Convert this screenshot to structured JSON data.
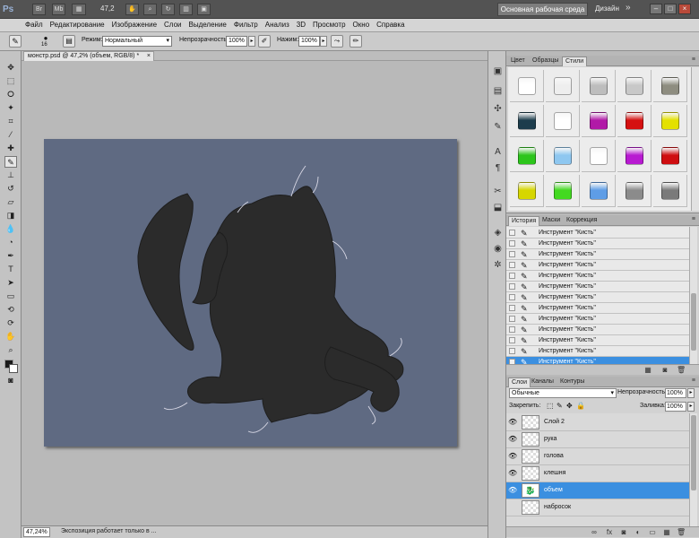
{
  "app": {
    "logo": "Ps",
    "top_buttons": [
      "Br",
      "Mb"
    ],
    "zoom_menu": "47,2",
    "workspace_label": "Основная рабочая среда",
    "design_label": "Дизайн",
    "more_label": "»",
    "window_controls": [
      "–",
      "□",
      "×"
    ]
  },
  "menu": [
    "Файл",
    "Редактирование",
    "Изображение",
    "Слои",
    "Выделение",
    "Фильтр",
    "Анализ",
    "3D",
    "Просмотр",
    "Окно",
    "Справка"
  ],
  "options_bar": {
    "brush_size": "16",
    "mode_label": "Режим:",
    "mode_value": "Нормальный",
    "opacity_label": "Непрозрачность:",
    "opacity_value": "100%",
    "pressure_label": "Нажим:",
    "pressure_value": "100%"
  },
  "document": {
    "tab_title": "монстр.psd @ 47,2% (объем, RGB/8) *",
    "tab_close": "×",
    "canvas_color": "#5f6a82"
  },
  "statusbar": {
    "zoom": "47,24%",
    "message": "Экспозиция работает только в ..."
  },
  "styles_panel": {
    "tabs": [
      "Цвет",
      "Образцы",
      "Стили"
    ],
    "active_tab": "Стили",
    "menu_icon": "≡",
    "swatches": [
      [
        "#ffffff",
        "#eeeeee",
        "#bdbdbd",
        "#c8c8c8",
        "#8e8d80"
      ],
      [
        "#1c3c4c",
        "#ffffff",
        "#b11aa7",
        "#d51010",
        "#e4e100"
      ],
      [
        "#2cc51b",
        "#8ec7f0",
        "#ffffff",
        "#b81ad1",
        "#cf0d10"
      ],
      [
        "#d6d600",
        "#43d921",
        "#5e9de6",
        "#8b8b8b",
        "#7a7a7a"
      ]
    ]
  },
  "history_panel": {
    "tabs": [
      "История",
      "Маски",
      "Коррекция"
    ],
    "active_tab": "История",
    "items": [
      "Инструмент \"Кисть\"",
      "Инструмент \"Кисть\"",
      "Инструмент \"Кисть\"",
      "Инструмент \"Кисть\"",
      "Инструмент \"Кисть\"",
      "Инструмент \"Кисть\"",
      "Инструмент \"Кисть\"",
      "Инструмент \"Кисть\"",
      "Инструмент \"Кисть\"",
      "Инструмент \"Кисть\"",
      "Инструмент \"Кисть\"",
      "Инструмент \"Кисть\"",
      "Инструмент \"Кисть\""
    ],
    "selected_index": 12
  },
  "layers_panel": {
    "tabs": [
      "Слои",
      "Каналы",
      "Контуры"
    ],
    "active_tab": "Слои",
    "blend_mode": "Обычные",
    "opacity_label": "Непрозрачность:",
    "opacity_value": "100%",
    "lock_label": "Закрепить:",
    "fill_label": "Заливка:",
    "fill_value": "100%",
    "layers": [
      {
        "name": "Слой 2",
        "visible": true,
        "selected": false
      },
      {
        "name": "рука",
        "visible": true,
        "selected": false
      },
      {
        "name": "голова",
        "visible": true,
        "selected": false
      },
      {
        "name": "клешня",
        "visible": true,
        "selected": false
      },
      {
        "name": "объем",
        "visible": true,
        "selected": true
      },
      {
        "name": "набросок",
        "visible": false,
        "selected": false
      }
    ]
  },
  "colors": {
    "selection": "#3b8fe0",
    "foreground": "#1a1a1a",
    "background": "#ffffff",
    "creature_fill": "#2b2b2b"
  }
}
